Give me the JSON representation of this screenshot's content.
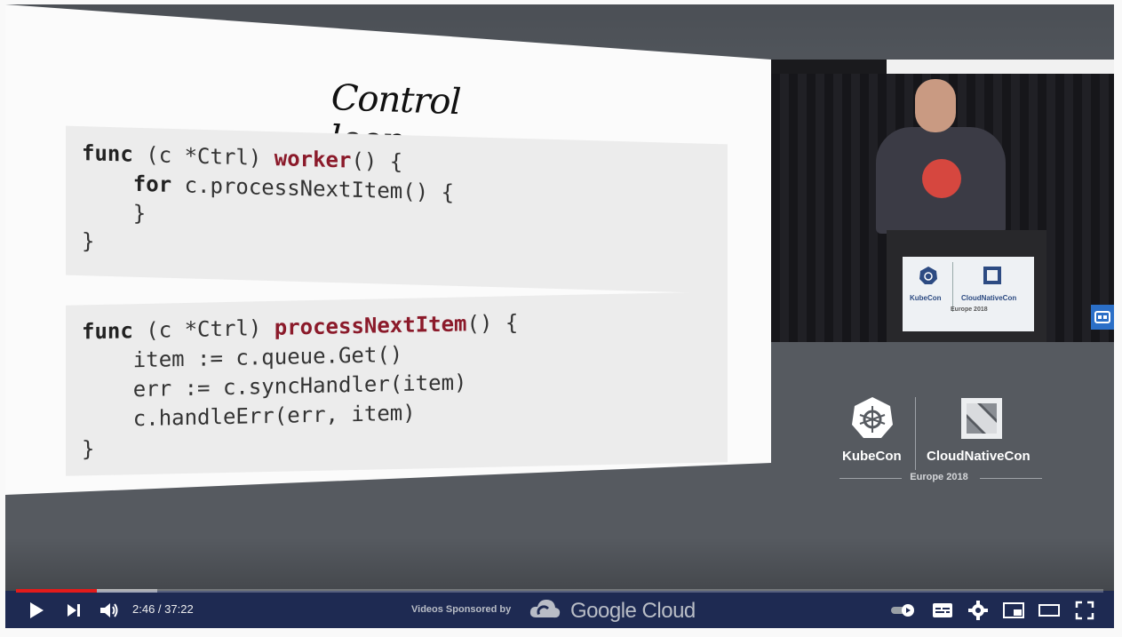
{
  "slide": {
    "title": "Control loop",
    "code_block_1": {
      "line1_kw": "func",
      "line1_mid": " (c *Ctrl) ",
      "line1_fn": "worker",
      "line1_end": "() {",
      "line2_indent": "    ",
      "line2_kw": "for",
      "line2_rest": " c.processNextItem() {",
      "line3": "    }",
      "line4": "}"
    },
    "code_block_2": {
      "line1_kw": "func",
      "line1_mid": " (c *Ctrl) ",
      "line1_fn": "processNextItem",
      "line1_end": "() {",
      "line2": "    item := c.queue.Get()",
      "line3": "    err := c.syncHandler(item)",
      "line4": "    c.handleErr(err, item)",
      "line5": "}"
    }
  },
  "speaker_sign": {
    "kube": "KubeCon",
    "cncf": "CloudNativeCon",
    "year": "Europe 2018"
  },
  "branding": {
    "kube": "KubeCon",
    "cncf": "CloudNativeCon",
    "year": "Europe 2018"
  },
  "player": {
    "time_display": "2:46 / 37:22",
    "sponsor_label": "Videos Sponsored by",
    "sponsor_name": "Google Cloud",
    "progress_played_fraction": 0.074,
    "progress_buffered_fraction": 0.13,
    "colors": {
      "progress": "#e21b1b",
      "bar": "#1e2a52",
      "accent_button": "#2b6fc7"
    },
    "icons": [
      "play-icon",
      "next-icon",
      "volume-icon",
      "autoplay-toggle-icon",
      "subtitles-icon",
      "settings-icon",
      "miniplayer-icon",
      "theater-mode-icon",
      "fullscreen-icon",
      "captions-side-icon"
    ]
  }
}
